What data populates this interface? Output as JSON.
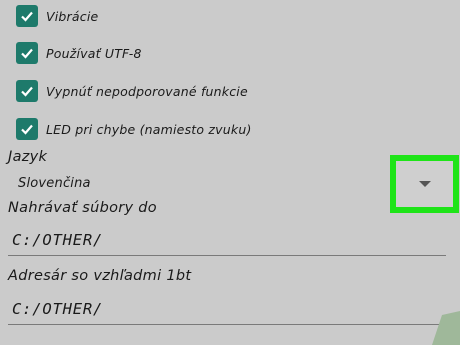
{
  "checkboxes": [
    {
      "label": "Vibrácie",
      "checked": true
    },
    {
      "label": "Používať UTF-8",
      "checked": true
    },
    {
      "label": "Vypnúť nepodporované funkcie",
      "checked": true
    },
    {
      "label": "LED pri chybe (namiesto zvuku)",
      "checked": true
    }
  ],
  "language": {
    "title": "Jazyk",
    "value": "Slovenčina"
  },
  "upload": {
    "title": "Nahrávať súbory do",
    "value": "C:/OTHER/"
  },
  "logs": {
    "title": "Adresár so vzhľadmi 1bt",
    "value": "C:/OTHER/"
  },
  "colors": {
    "checkbox": "#1e7a6b",
    "highlight": "#1ee418",
    "background": "#cbcbcb"
  },
  "icons": {
    "checkbox": "checkmark-icon",
    "dropdown": "dropdown-arrow-icon"
  }
}
